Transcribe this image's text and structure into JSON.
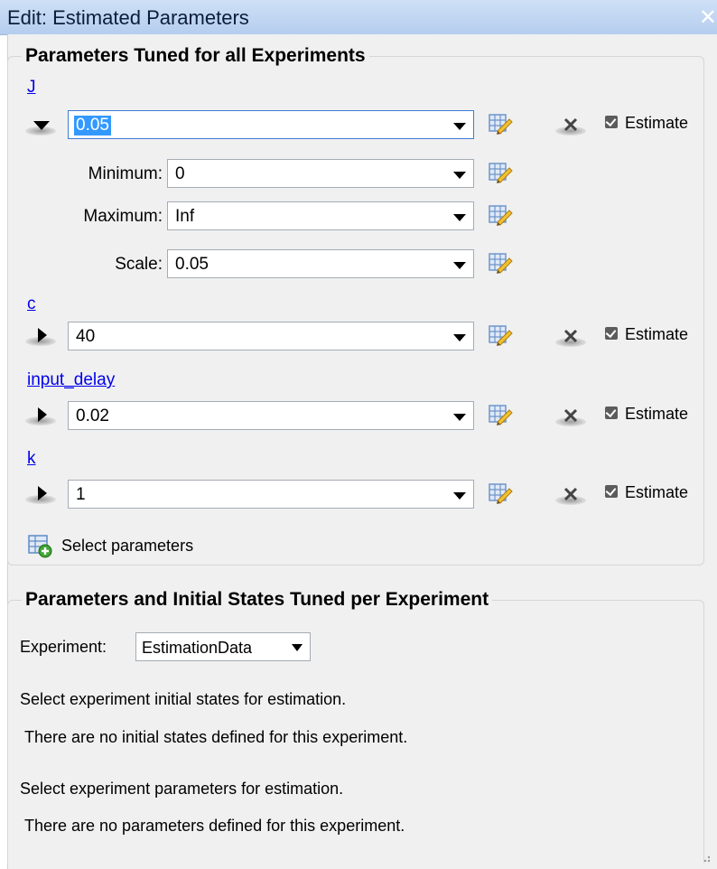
{
  "window": {
    "title": "Edit: Estimated Parameters",
    "close_glyph": "✕"
  },
  "section1": {
    "heading": "Parameters Tuned for all Experiments",
    "params": [
      {
        "name": "J",
        "value": "0.05",
        "estimate_label": "Estimate",
        "expanded": true,
        "min_label": "Minimum:",
        "min_value": "0",
        "max_label": "Maximum:",
        "max_value": "Inf",
        "scale_label": "Scale:",
        "scale_value": "0.05"
      },
      {
        "name": "c",
        "value": "40",
        "estimate_label": "Estimate",
        "expanded": false
      },
      {
        "name": "input_delay",
        "value": "0.02",
        "estimate_label": "Estimate",
        "expanded": false
      },
      {
        "name": "k",
        "value": "1",
        "estimate_label": "Estimate",
        "expanded": false
      }
    ],
    "select_label": "Select parameters"
  },
  "section2": {
    "heading": "Parameters and Initial States Tuned per Experiment",
    "experiment_label": "Experiment:",
    "experiment_value": "EstimationData",
    "states_prompt": "Select experiment initial states for estimation.",
    "states_message": "There are no initial states defined for this experiment.",
    "params_prompt": "Select experiment parameters for estimation.",
    "params_message": "There are no parameters defined for this experiment."
  },
  "colors": {
    "link": "#0000ee",
    "highlight": "#3399ff",
    "titlebar": "#c5d8f3"
  },
  "icons": [
    "expand-arrow-icon",
    "table-edit-icon",
    "delete-x-icon",
    "checkbox-checked-icon",
    "add-table-icon",
    "dropdown-arrow-icon",
    "resize-grip-icon"
  ]
}
